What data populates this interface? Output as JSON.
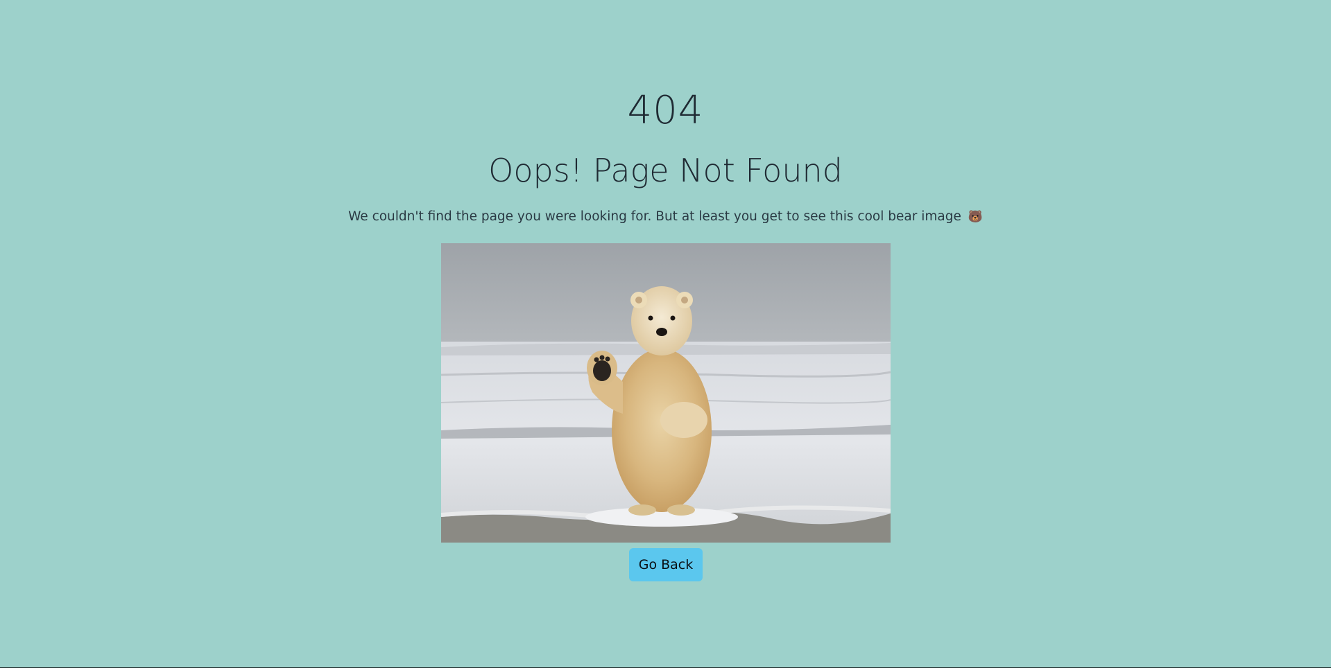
{
  "error": {
    "code": "404",
    "title": "Oops! Page Not Found",
    "message": "We couldn't find the page you were looking for. But at least you get to see this cool bear image",
    "emoji": "🐻"
  },
  "image": {
    "subject": "polar-bear-waving-on-snow"
  },
  "actions": {
    "go_back_label": "Go Back"
  },
  "colors": {
    "background": "#9dd1cb",
    "button": "#5bc7ee",
    "text": "#1f2a33"
  }
}
